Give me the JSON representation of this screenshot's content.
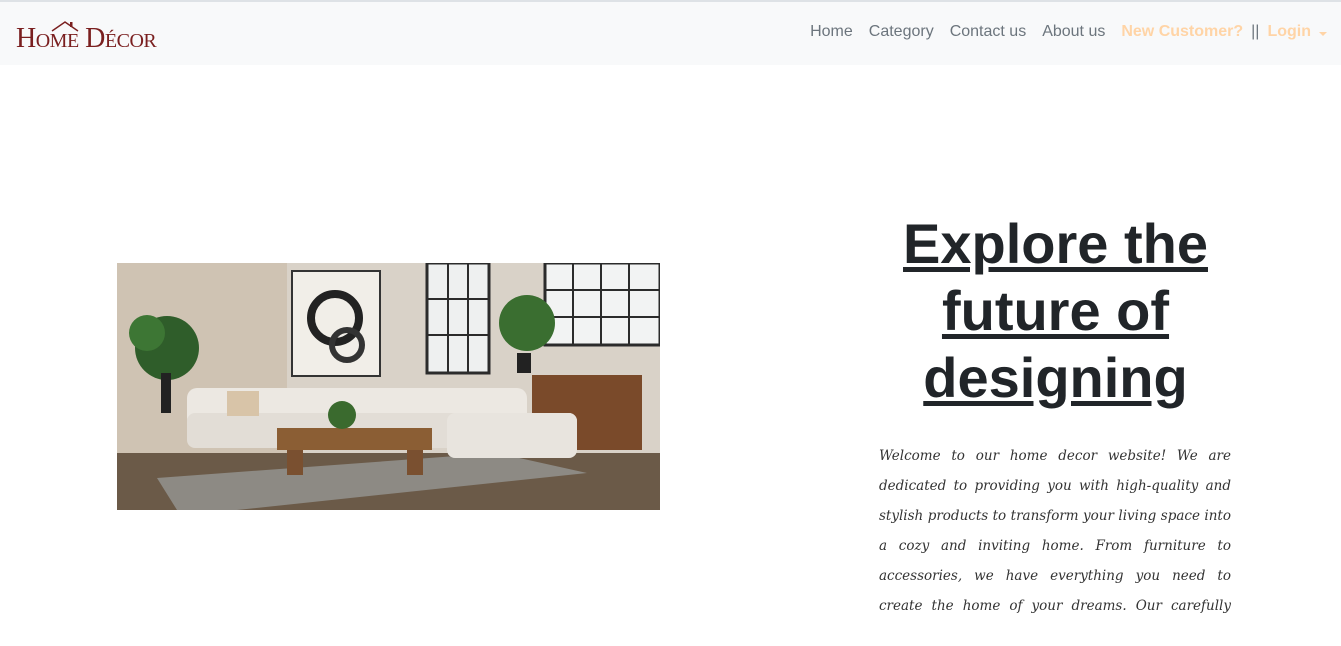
{
  "navbar": {
    "brand": "Home Décor",
    "links": [
      "Home",
      "Category",
      "Contact us",
      "About us"
    ],
    "new_customer": "New Customer?",
    "separator": "||",
    "login": "Login"
  },
  "colors": {
    "brand": "#7a1f1f",
    "accent": "#ffd4a6",
    "nav_text": "#6c757d",
    "navbar_bg": "#f8f9fa"
  },
  "hero": {
    "title": "Explore the future of designing",
    "description": "Welcome to our home decor website! We are dedicated to providing you with high-quality and stylish products to transform your living space into a cozy and inviting home. From furniture to accessories, we have everything you need to create the home of your dreams. Our carefully curated selection features a range of designs, so"
  }
}
